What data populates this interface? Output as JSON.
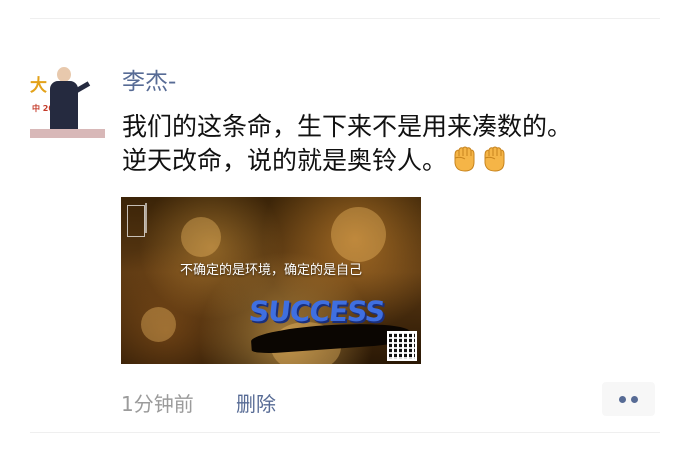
{
  "post": {
    "username": "李杰-",
    "text_line1": "我们的这条命，生下来不是用来凑数的。",
    "text_line2": "逆天改命，说的就是奥铃人。",
    "emoji_icon": "fist-emoji-icon",
    "image": {
      "caption": "不确定的是环境，确定的是自己",
      "success_word": "SUCCESS"
    },
    "avatar": {
      "banner_text": "大",
      "sub_text": "中  201"
    }
  },
  "footer": {
    "timestamp": "1分钟前",
    "delete_label": "删除",
    "more_icon": "more-dots-icon"
  },
  "colors": {
    "link": "#576b95",
    "text": "#111111",
    "muted": "#9b9b9b"
  }
}
